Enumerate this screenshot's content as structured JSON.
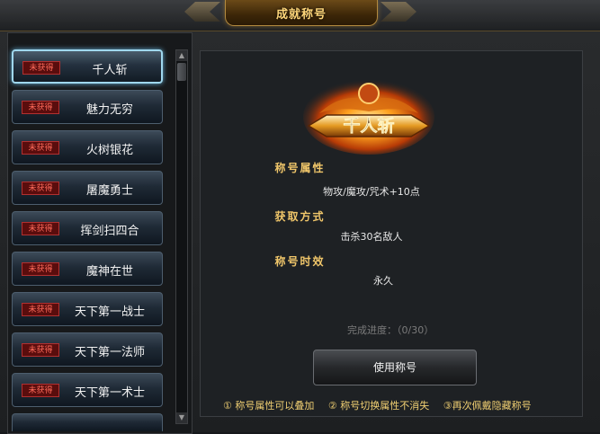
{
  "window": {
    "title": "成就称号"
  },
  "title_list": {
    "badge_text": "未获得",
    "items": [
      {
        "label": "千人斩",
        "selected": true
      },
      {
        "label": "魅力无穷"
      },
      {
        "label": "火树银花"
      },
      {
        "label": "屠魔勇士"
      },
      {
        "label": "挥剑扫四合"
      },
      {
        "label": "魔神在世"
      },
      {
        "label": "天下第一战士"
      },
      {
        "label": "天下第一法师"
      },
      {
        "label": "天下第一术士"
      }
    ]
  },
  "detail": {
    "emblem_text": "千人斩",
    "attr_heading": "称号属性",
    "attr_value": "物攻/魔攻/咒术+10点",
    "obtain_heading": "获取方式",
    "obtain_value": "击杀30名敌人",
    "duration_heading": "称号时效",
    "duration_value": "永久",
    "progress_text": "完成进度：（0/30）",
    "use_button": "使用称号"
  },
  "notes": [
    "① 称号属性可以叠加",
    "② 称号切换属性不消失",
    "③再次佩戴隐藏称号"
  ],
  "colors": {
    "gold": "#f0c66a",
    "badge_red": "#ff6a5a",
    "selected_glow": "#9fd7ee"
  }
}
